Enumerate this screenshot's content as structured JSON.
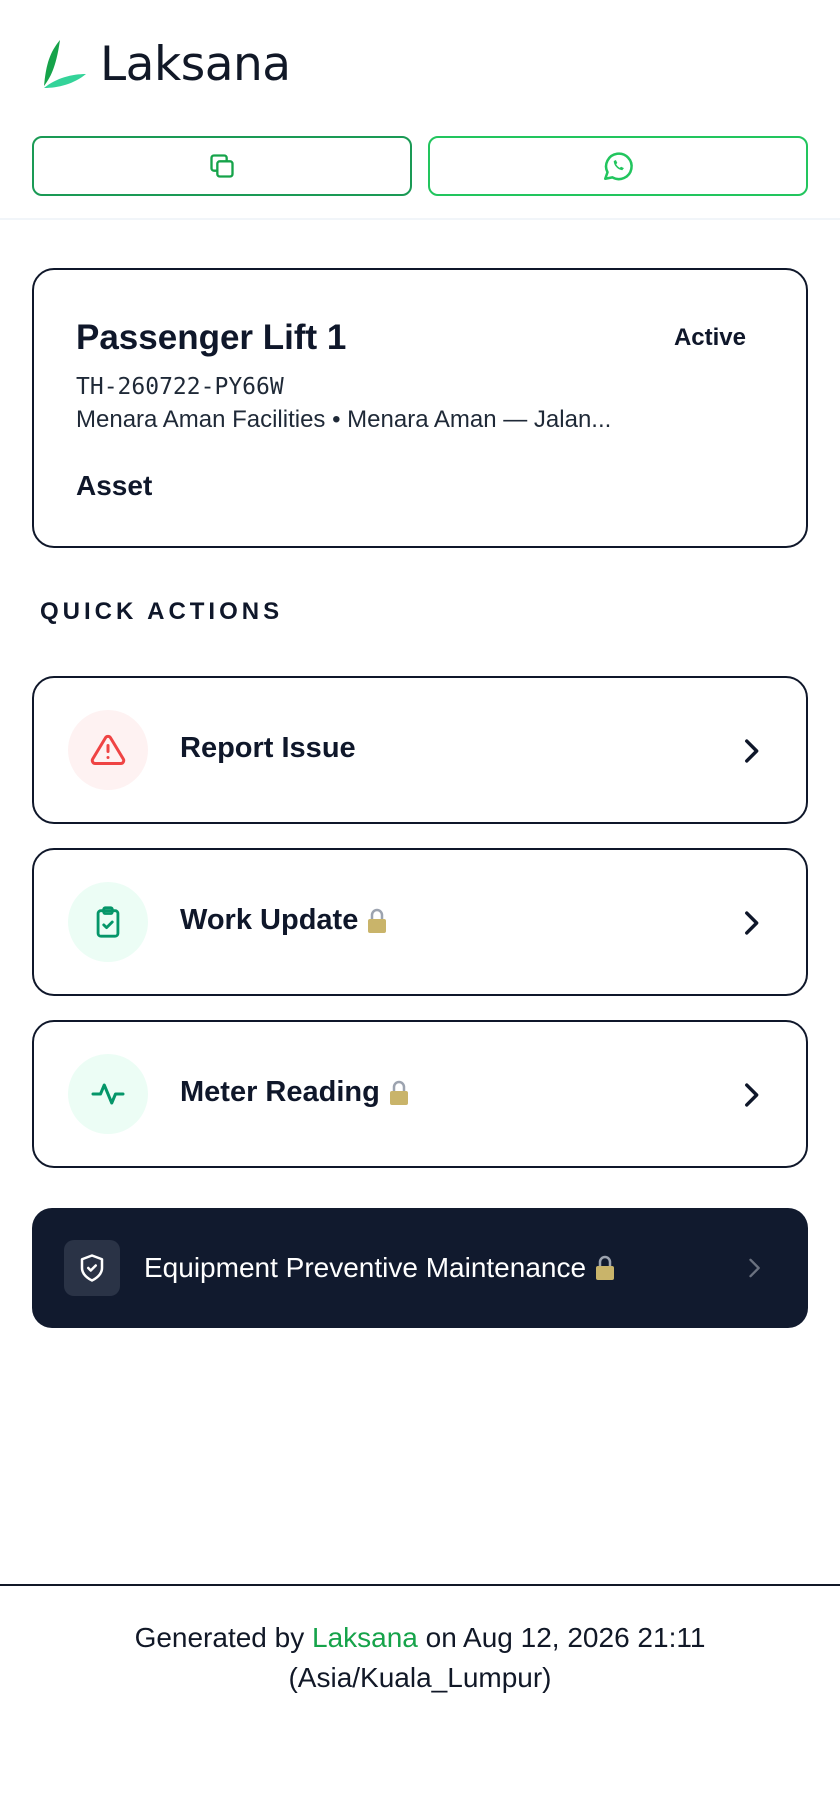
{
  "header": {
    "brand_name": "Laksana",
    "copy_button_icon": "copy-icon",
    "whatsapp_button_icon": "whatsapp-icon"
  },
  "asset": {
    "name": "Passenger Lift 1",
    "status": "Active",
    "code": "TH-260722-PY66W",
    "location": "Menara Aman Facilities • Menara Aman — Jalan...",
    "type": "Asset"
  },
  "quick_actions": {
    "title": "QUICK ACTIONS",
    "items": [
      {
        "label": "Report Issue",
        "icon": "warning-triangle-icon",
        "locked": false
      },
      {
        "label": "Work Update",
        "icon": "clipboard-check-icon",
        "locked": true
      },
      {
        "label": "Meter Reading",
        "icon": "pulse-icon",
        "locked": true
      }
    ]
  },
  "maintenance": {
    "label": "Equipment Preventive Maintenance",
    "icon": "shield-check-icon",
    "locked": true
  },
  "footer": {
    "prefix": "Generated by ",
    "brand": "Laksana",
    "suffix": " on Aug 12, 2026 21:11",
    "timezone": "(Asia/Kuala_Lumpur)"
  },
  "colors": {
    "brand_green": "#16a34a",
    "dark_navy": "#111a2e",
    "danger_red": "#ef4444"
  }
}
